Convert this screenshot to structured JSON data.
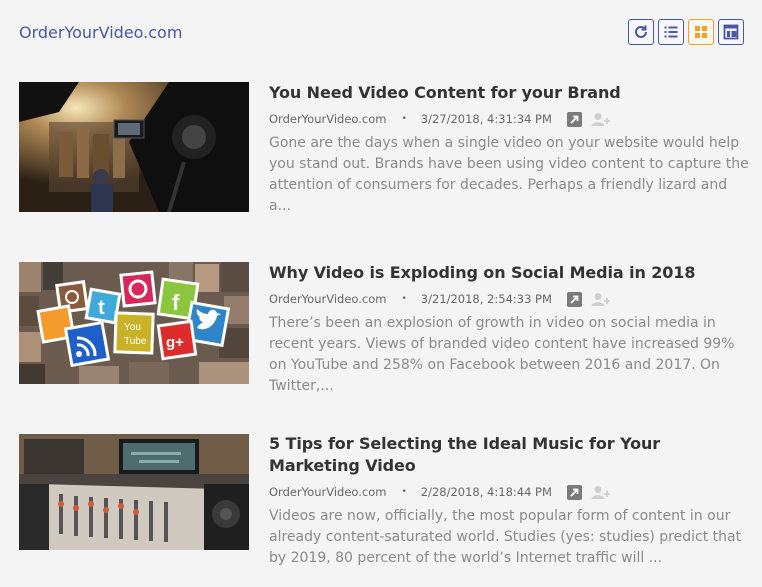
{
  "site": {
    "title": "OrderYourVideo.com"
  },
  "toolbar": {
    "buttons": [
      {
        "icon": "refresh-icon",
        "active": false
      },
      {
        "icon": "list-view-icon",
        "active": false
      },
      {
        "icon": "grid-view-icon",
        "active": true
      },
      {
        "icon": "card-view-icon",
        "active": false
      }
    ],
    "accent": "#4a56a6",
    "active_accent": "#f0a02c"
  },
  "items": [
    {
      "title": "You Need Video Content for your Brand",
      "source": "OrderYourVideo.com",
      "separator": "•",
      "date": "3/27/2018, 4:31:34 PM",
      "excerpt": "Gone are the days when a single video on your website would help you stand out. Brands have been using video content to capture the attention of consumers for decades. Perhaps a friendly lizard and a..."
    },
    {
      "title": "Why Video is Exploding on Social Media in 2018",
      "source": "OrderYourVideo.com",
      "separator": "•",
      "date": "3/21/2018, 2:54:33 PM",
      "excerpt": "There’s been an explosion of growth in video on social media in recent years. Views of branded video content have increased 99% on YouTube and 258% on Facebook between 2016 and 2017. On Twitter,...",
      "thumb_text": {
        "youtube_1": "You",
        "youtube_2": "Tube",
        "gplus": "g+"
      }
    },
    {
      "title": "5 Tips for Selecting the Ideal Music for Your Marketing Video",
      "source": "OrderYourVideo.com",
      "separator": "•",
      "date": "2/28/2018, 4:18:44 PM",
      "excerpt": "Videos are now, officially, the most popular form of content in our already content-saturated world. Studies (yes: studies) predict that by 2019, 80 percent of the world’s Internet traffic will ..."
    }
  ]
}
